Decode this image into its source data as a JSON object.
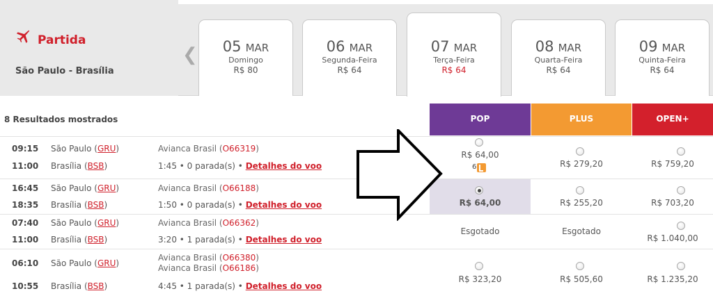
{
  "header": {
    "title": "Partida",
    "route": "São Paulo - Brasília"
  },
  "dates": [
    {
      "day": "05",
      "month": "MAR",
      "weekday": "Domingo",
      "price": "R$ 80"
    },
    {
      "day": "06",
      "month": "MAR",
      "weekday": "Segunda-Feira",
      "price": "R$ 64"
    },
    {
      "day": "07",
      "month": "MAR",
      "weekday": "Terça-Feira",
      "price": "R$ 64"
    },
    {
      "day": "08",
      "month": "MAR",
      "weekday": "Quarta-Feira",
      "price": "R$ 64"
    },
    {
      "day": "09",
      "month": "MAR",
      "weekday": "Quinta-Feira",
      "price": "R$ 64"
    }
  ],
  "results_label": "8 Resultados mostrados",
  "fares": {
    "pop": "POP",
    "plus": "PLUS",
    "open": "OPEN+"
  },
  "details_label": "Detalhes do voo",
  "flights": [
    {
      "dep_time": "09:15",
      "arr_time": "11:00",
      "dep_city": "São Paulo",
      "dep_code": "GRU",
      "arr_city": "Brasília",
      "arr_code": "BSB",
      "airline": "Avianca Brasil",
      "flight_no": "O66319",
      "duration": "1:45 •",
      "stops": "0 parada(s) •",
      "pop": "R$ 64,00",
      "plus": "R$ 279,20",
      "open": "R$ 759,20",
      "seats_left": "6"
    },
    {
      "dep_time": "16:45",
      "arr_time": "18:35",
      "dep_city": "São Paulo",
      "dep_code": "GRU",
      "arr_city": "Brasília",
      "arr_code": "BSB",
      "airline": "Avianca Brasil",
      "flight_no": "O66188",
      "duration": "1:50 •",
      "stops": "0 parada(s) •",
      "pop": "R$ 64,00",
      "plus": "R$ 255,20",
      "open": "R$ 703,20"
    },
    {
      "dep_time": "07:40",
      "arr_time": "11:00",
      "dep_city": "São Paulo",
      "dep_code": "GRU",
      "arr_city": "Brasília",
      "arr_code": "BSB",
      "airline": "Avianca Brasil",
      "flight_no": "O66362",
      "duration": "3:20 •",
      "stops": "1 parada(s) •",
      "pop": "Esgotado",
      "plus": "Esgotado",
      "open": "R$ 1.040,00"
    },
    {
      "dep_time": "06:10",
      "arr_time": "10:55",
      "dep_city": "São Paulo",
      "dep_code": "GRU",
      "arr_city": "Brasília",
      "arr_code": "BSB",
      "airline": "Avianca Brasil",
      "flight_no": "O66380",
      "airline2": "Avianca Brasil",
      "flight_no2": "O66186",
      "duration": "4:45 •",
      "stops": "1 parada(s) •",
      "pop": "R$ 323,20",
      "plus": "R$ 505,60",
      "open": "R$ 1.235,20"
    }
  ],
  "colors": {
    "accent_red": "#d0202b",
    "pop": "#6e3a96",
    "plus": "#f39a32",
    "open": "#d3202c",
    "selected_bg": "#e1dde9"
  },
  "icons": {
    "plane": "plane-icon",
    "prev": "chevron-left-icon",
    "annotation": "arrow-right-icon"
  }
}
